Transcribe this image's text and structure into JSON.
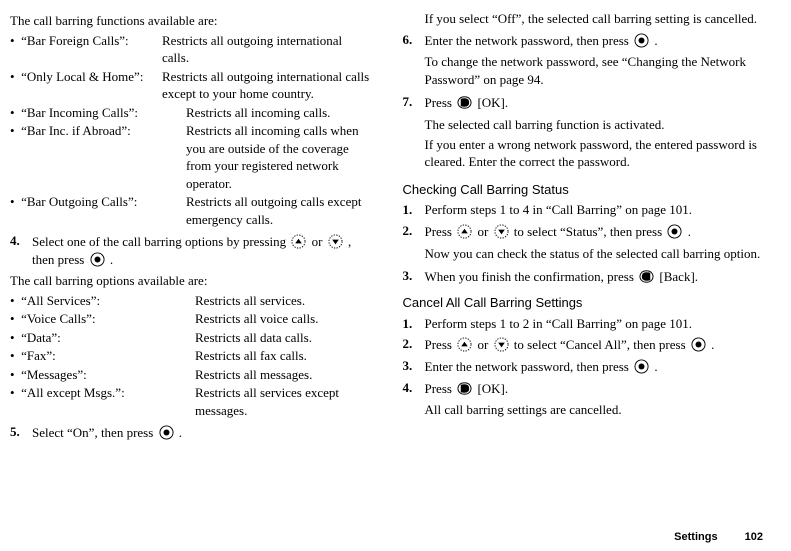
{
  "left": {
    "intro_funcs": "The call barring functions available are:",
    "bullet": "•",
    "funcs": {
      "barForeign": {
        "term": "“Bar Foreign Calls”:",
        "desc": "Restricts all outgoing international calls."
      },
      "onlyLocal": {
        "term": "“Only Local & Home”:",
        "desc": "Restricts all outgoing international calls except to your home country."
      },
      "barIncoming": {
        "term": "“Bar Incoming Calls”:",
        "desc": "Restricts all incoming calls."
      },
      "barIncAbroad": {
        "term": "“Bar Inc. if Abroad”:",
        "desc": "Restricts all incoming calls when you are outside of the coverage from your registered network operator."
      },
      "barOutgoing": {
        "term": "“Bar Outgoing Calls”:",
        "desc": "Restricts all outgoing calls except emergency calls."
      }
    },
    "step4": {
      "num": "4.",
      "pre": "Select one of the call barring options by pressing ",
      "or": " or ",
      "mid": ", then press ",
      "dot": "."
    },
    "intro_opts": "The call barring options available are:",
    "opts": {
      "all": {
        "term": "“All Services”:",
        "desc": "Restricts all services."
      },
      "voice": {
        "term": "“Voice Calls”:",
        "desc": "Restricts all voice calls."
      },
      "data": {
        "term": "“Data”:",
        "desc": "Restricts all data calls."
      },
      "fax": {
        "term": "“Fax”:",
        "desc": "Restricts all fax calls."
      },
      "msg": {
        "term": "“Messages”:",
        "desc": "Restricts all messages."
      },
      "exmsg": {
        "term": "“All except Msgs.”:",
        "desc": "Restricts all services except messages."
      }
    },
    "step5": {
      "num": "5.",
      "pre": "Select “On”, then press ",
      "dot": "."
    }
  },
  "right": {
    "off_note": "If you select “Off”, the selected call barring setting is cancelled.",
    "s6": {
      "num": "6.",
      "pre": "Enter the network password, then press ",
      "dot": ".",
      "sub": "To change the network password, see “Changing the Network Password” on page 94."
    },
    "s7": {
      "num": "7.",
      "pre": "Press ",
      "ok": " [OK].",
      "sub1": "The selected call barring function is activated.",
      "sub2": "If you enter a wrong network password, the entered password is cleared. Enter the correct the password."
    },
    "h_check": "Checking Call Barring Status",
    "c1": {
      "num": "1.",
      "text": "Perform steps 1 to 4 in  “Call Barring” on page 101."
    },
    "c2": {
      "num": "2.",
      "pre": "Press ",
      "or": " or ",
      "mid": " to select “Status”, then press ",
      "dot": ".",
      "sub": "Now you can check the status of the selected call barring option."
    },
    "c3": {
      "num": "3.",
      "pre": "When you finish the confirmation, press ",
      "back": " [Back]."
    },
    "h_cancel": "Cancel All Call Barring Settings",
    "x1": {
      "num": "1.",
      "text": "Perform steps 1 to 2 in “Call Barring” on page 101."
    },
    "x2": {
      "num": "2.",
      "pre": "Press ",
      "or": " or ",
      "mid": " to select “Cancel All”, then press ",
      "dot": "."
    },
    "x3": {
      "num": "3.",
      "pre": "Enter the network password, then press ",
      "dot": "."
    },
    "x4": {
      "num": "4.",
      "pre": "Press ",
      "ok": " [OK].",
      "sub": "All call barring settings are cancelled."
    }
  },
  "footer": {
    "label": "Settings",
    "page": "102"
  }
}
